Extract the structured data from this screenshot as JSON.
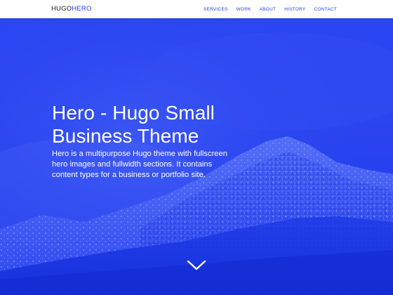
{
  "navbar": {
    "brand_part1": "HUGO",
    "brand_part2": "HERO",
    "links": [
      "SERVICES",
      "WORK",
      "ABOUT",
      "HISTORY",
      "CONTACT"
    ]
  },
  "hero": {
    "title": "Hero - Hugo Small Business Theme",
    "description": "Hero is a multipurpose Hugo theme with fullscreen hero images and fullwidth sections. It contains content types for a business or portfolio site.",
    "scroll_icon": "chevron-down-icon"
  },
  "colors": {
    "accent": "#1f3cf0",
    "navbar_bg": "#ffffff",
    "hero_text": "#ffffff"
  }
}
